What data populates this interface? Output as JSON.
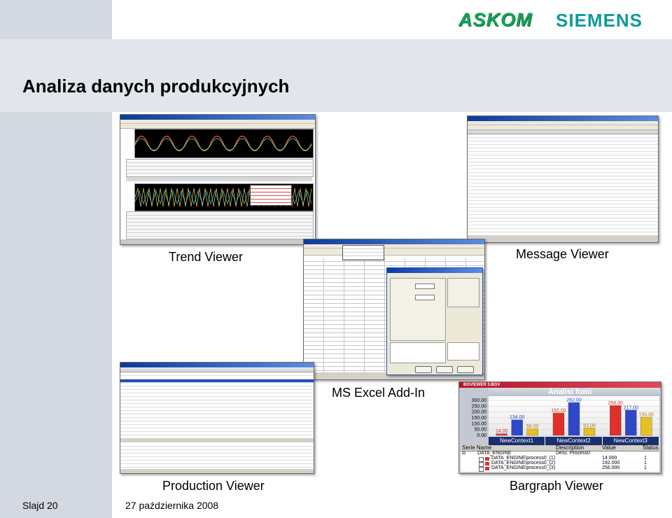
{
  "slide": {
    "title": "Analiza danych produkcyjnych",
    "logo_left": "ASKOM",
    "logo_right": "SIEMENS",
    "slide_number": "Slajd 20",
    "date": "27 października 2008"
  },
  "captions": {
    "trend_viewer": "Trend Viewer",
    "message_viewer": "Message Viewer",
    "excel_addin": "MS Excel Add-In",
    "production_viewer": "Production Viewer",
    "bargraph_viewer": "Bargraph Viewer"
  },
  "bargraph": {
    "window_title": "BGVIEWER 3.BGV",
    "chart_title": "Analisi fumi",
    "tabs": [
      "NewContext1",
      "NewContext2",
      "NewContext3"
    ],
    "list_headers": [
      "Serie Name",
      "Description",
      "Value",
      "Status"
    ],
    "list_rows": [
      {
        "name": "DATA_ENGINE",
        "desc": "Desc. Process0",
        "value": "",
        "status": ""
      },
      {
        "name": "DATA_ENGINE\\process0_(1)",
        "desc": "",
        "value": "14.000",
        "status": "1"
      },
      {
        "name": "DATA_ENGINE\\process0_(2)",
        "desc": "",
        "value": "192.000",
        "status": "1"
      },
      {
        "name": "DATA_ENGINE\\process0_(3)",
        "desc": "",
        "value": "256.000",
        "status": "1"
      }
    ],
    "axis_ticks": [
      "300.00",
      "250.00",
      "200.00",
      "150.00",
      "100.00",
      "50.00",
      "0.00"
    ],
    "colors": {
      "red": "#e0302a",
      "blue": "#2e48c8",
      "yellow": "#e8c020",
      "gray": "#b8b8b8"
    }
  },
  "chart_data": {
    "type": "bar",
    "title": "Analisi fumi",
    "categories": [
      "NewContext1",
      "NewContext2",
      "NewContext3"
    ],
    "ylim": [
      0,
      300
    ],
    "series": [
      {
        "values": [
          14.0,
          192.0,
          256.0
        ]
      },
      {
        "values": [
          134.0,
          282.0,
          217.0
        ]
      },
      {
        "values": [
          56.0,
          63.0,
          156.0
        ]
      }
    ]
  }
}
